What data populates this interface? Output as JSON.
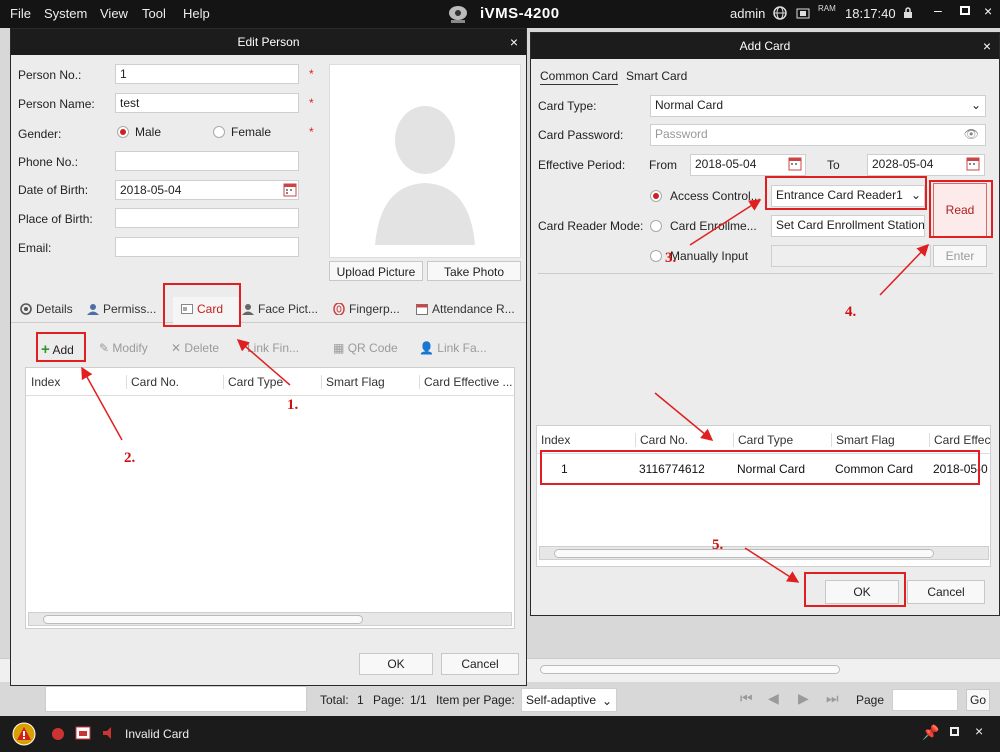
{
  "app": {
    "title": "iVMS-4200",
    "menu": [
      "File",
      "System",
      "View",
      "Tool",
      "Help"
    ],
    "user": "admin",
    "time": "18:17:40",
    "ram_label": "RAM"
  },
  "edit_person": {
    "title": "Edit Person",
    "close": "×",
    "fields": {
      "person_no_label": "Person No.:",
      "person_no": "1",
      "person_name_label": "Person Name:",
      "person_name": "test",
      "gender_label": "Gender:",
      "male": "Male",
      "female": "Female",
      "phone_label": "Phone No.:",
      "phone": "",
      "dob_label": "Date of Birth:",
      "dob": "2018-05-04",
      "place_label": "Place of Birth:",
      "place": "",
      "email_label": "Email:",
      "email": "",
      "required": "*"
    },
    "upload_picture": "Upload Picture",
    "take_photo": "Take Photo",
    "tabs": [
      "Details",
      "Permiss...",
      "Card",
      "Face Pict...",
      "Fingerp...",
      "Attendance R..."
    ],
    "toolbar": [
      "Add",
      "Modify",
      "Delete",
      "Link Fin...",
      "QR Code",
      "Link Fa..."
    ],
    "columns": [
      "Index",
      "Card No.",
      "Card Type",
      "Smart Flag",
      "Card Effective ..."
    ],
    "ok": "OK",
    "cancel": "Cancel"
  },
  "add_card": {
    "title": "Add Card",
    "close": "×",
    "tabs": [
      "Common Card",
      "Smart Card"
    ],
    "card_type_label": "Card Type:",
    "card_type": "Normal Card",
    "card_password_label": "Card Password:",
    "card_password_placeholder": "Password",
    "effective_period_label": "Effective Period:",
    "from_label": "From",
    "from": "2018-05-04",
    "to_label": "To",
    "to": "2028-05-04",
    "reader_mode_label": "Card Reader Mode:",
    "modes": [
      "Access Control...",
      "Card Enrollme...",
      "Manually Input"
    ],
    "access_reader": "Entrance Card Reader1",
    "enrollment_station": "Set Card Enrollment Station",
    "read": "Read",
    "enter": "Enter",
    "columns": [
      "Index",
      "Card No.",
      "Card Type",
      "Smart Flag",
      "Card Effec"
    ],
    "rows": [
      {
        "index": "1",
        "card_no": "3116774612",
        "card_type": "Normal Card",
        "smart_flag": "Common Card",
        "effective": "2018-05-0"
      }
    ],
    "ok": "OK",
    "cancel": "Cancel"
  },
  "pager": {
    "total_label": "Total:",
    "total": "1",
    "page_label": "Page:",
    "page": "1/1",
    "ipp_label": "Item per Page:",
    "ipp": "Self-adaptive",
    "page_input_label": "Page",
    "go": "Go"
  },
  "status": {
    "alarm_text": "Invalid Card"
  },
  "annotations": [
    "1.",
    "2.",
    "3.",
    "4.",
    "5."
  ],
  "colors": {
    "annotation": "#e02020",
    "titlebar": "#1c1c1c",
    "accent_red": "#d02020"
  }
}
